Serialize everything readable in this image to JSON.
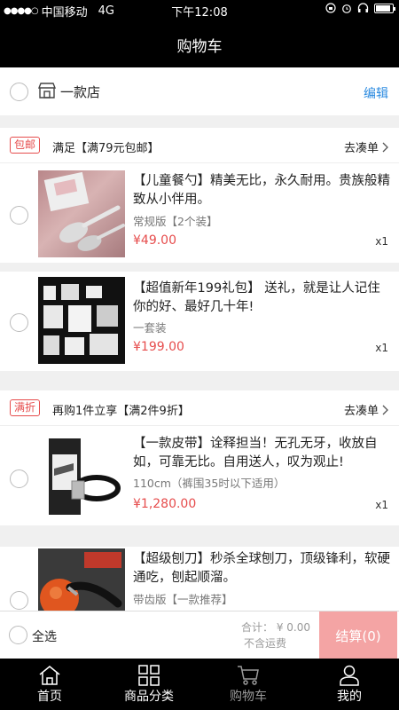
{
  "status_bar": {
    "signal_dots": "●●●●○",
    "carrier": "中国移动",
    "network": "4G",
    "time": "下午12:08"
  },
  "header": {
    "title": "购物车"
  },
  "shop": {
    "name": "一款店",
    "edit_label": "编辑"
  },
  "promos": [
    {
      "badge": "包邮",
      "text": "满足【满79元包邮】",
      "link": "去凑单"
    },
    {
      "badge": "满折",
      "text": "再购1件立享【满2件9折】",
      "link": "去凑单"
    }
  ],
  "items": [
    {
      "title": "【儿童餐勺】精美无比，永久耐用。贵族般精致从小伴用。",
      "spec": "常规版【2个装】",
      "price": "¥49.00",
      "qty": "x1"
    },
    {
      "title": "【超值新年199礼包】 送礼，就是让人记住你的好、最好几十年!",
      "spec": "一套装",
      "price": "¥199.00",
      "qty": "x1"
    },
    {
      "title": "【一款皮带】诠释担当！无孔无牙，收放自如，可靠无比。自用送人，叹为观止!",
      "spec": "110cm（裤围35时以下适用）",
      "price": "¥1,280.00",
      "qty": "x1"
    },
    {
      "title": "【超级刨刀】秒杀全球刨刀，顶级锋利，软硬通吃，刨起顺溜。",
      "spec": "带齿版【一款推荐】",
      "price": "",
      "qty": ""
    }
  ],
  "checkout": {
    "select_all": "全选",
    "total": "合计： ¥ 0.00",
    "shipping_note": "不含运费",
    "button": "结算(0)"
  },
  "tabs": [
    {
      "label": "首页",
      "icon": "home-icon"
    },
    {
      "label": "商品分类",
      "icon": "category-grid-icon"
    },
    {
      "label": "购物车",
      "icon": "cart-icon"
    },
    {
      "label": "我的",
      "icon": "user-icon"
    }
  ],
  "colors": {
    "accent_red": "#e64c4c",
    "edit_blue": "#2a8ae0",
    "checkout_pink": "#f4a4a4",
    "bar_black": "#000000"
  }
}
